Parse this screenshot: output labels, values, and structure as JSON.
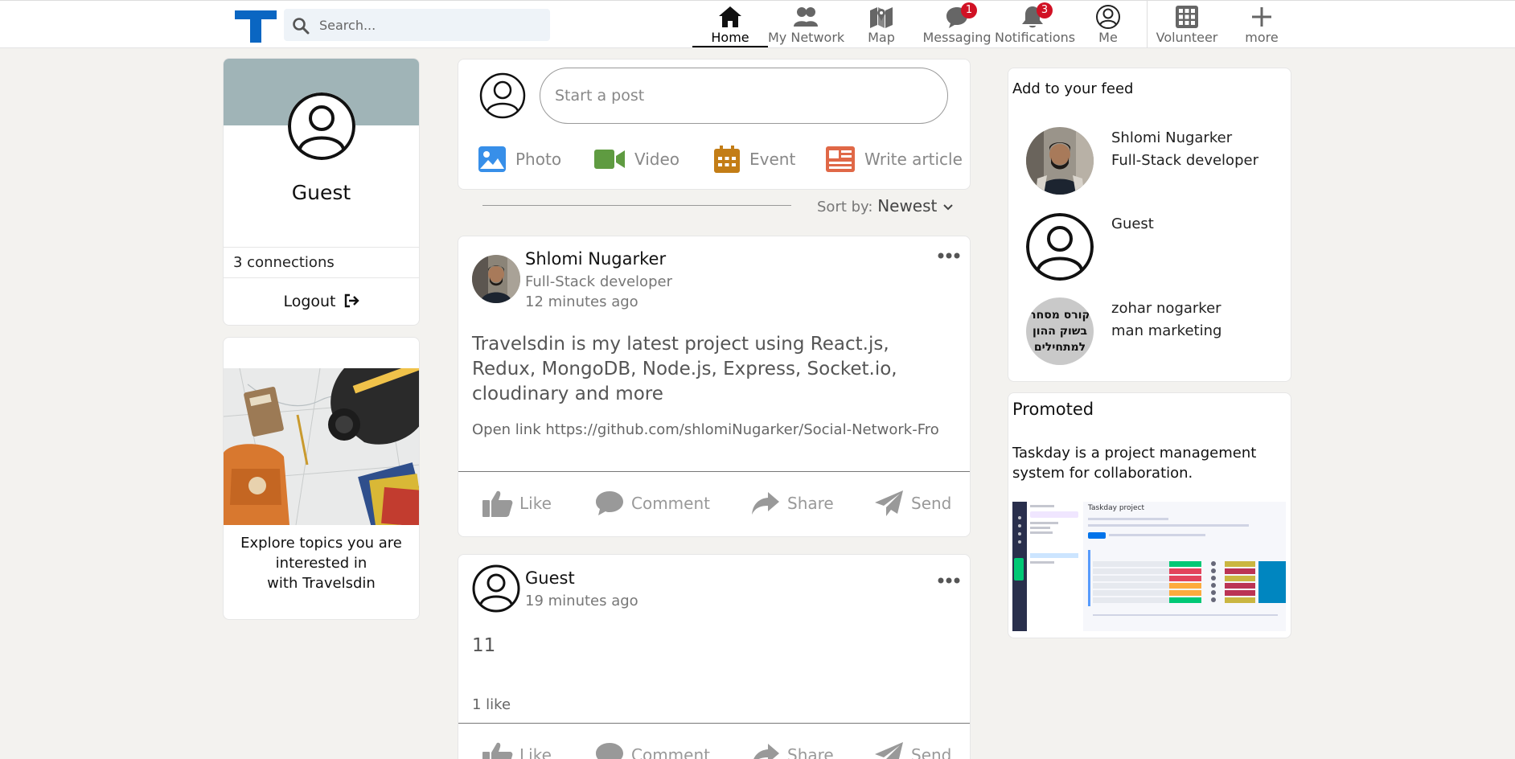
{
  "nav": {
    "search_placeholder": "Search...",
    "items": [
      {
        "label": "Home"
      },
      {
        "label": "My Network"
      },
      {
        "label": "Map"
      },
      {
        "label": "Messaging",
        "badge": "1"
      },
      {
        "label": "Notifications",
        "badge": "3"
      },
      {
        "label": "Me"
      },
      {
        "label": "Volunteer"
      },
      {
        "label": "more"
      }
    ]
  },
  "profile": {
    "name": "Guest",
    "connections": "3 connections",
    "logout": "Logout"
  },
  "explore": {
    "line1": "Explore topics you are",
    "line2": "interested in",
    "line3": "with Travelsdin"
  },
  "composer": {
    "placeholder": "Start a post",
    "actions": [
      "Photo",
      "Video",
      "Event",
      "Write article"
    ]
  },
  "sort": {
    "label": "Sort by:",
    "value": "Newest"
  },
  "posts": [
    {
      "author": "Shlomi Nugarker",
      "role": "Full-Stack developer",
      "time": "12 minutes ago",
      "text": "Travelsdin is my latest project using React.js, Redux, MongoDB, Node.js, Express, Socket.io, cloudinary and more",
      "link": "Open link https://github.com/shlomiNugarker/Social-Network-Front-",
      "actions": [
        "Like",
        "Comment",
        "Share",
        "Send"
      ]
    },
    {
      "author": "Guest",
      "time": "19 minutes ago",
      "text": "11",
      "likes": "1 like",
      "actions": [
        "Like",
        "Comment",
        "Share",
        "Send"
      ]
    }
  ],
  "feed": {
    "title": "Add to your feed",
    "people": [
      {
        "name": "Shlomi Nugarker",
        "role": "Full-Stack developer"
      },
      {
        "name": "Guest",
        "role": ""
      },
      {
        "name": "zohar nogarker",
        "role": "man marketing",
        "avatar_text": [
          "קורס מסחר",
          "בשוק ההון",
          "למתחילים"
        ]
      }
    ]
  },
  "promoted": {
    "title": "Promoted",
    "text": "Taskday is a project management system for collaboration.",
    "screenshot_title": "Taskday project"
  },
  "colors": {
    "brand": "#0a66c2",
    "badge": "#d11124",
    "banner": "#a0b4b7",
    "photo": "#378fe9",
    "video": "#5f9b41",
    "event": "#c37d16",
    "article": "#e06847"
  }
}
